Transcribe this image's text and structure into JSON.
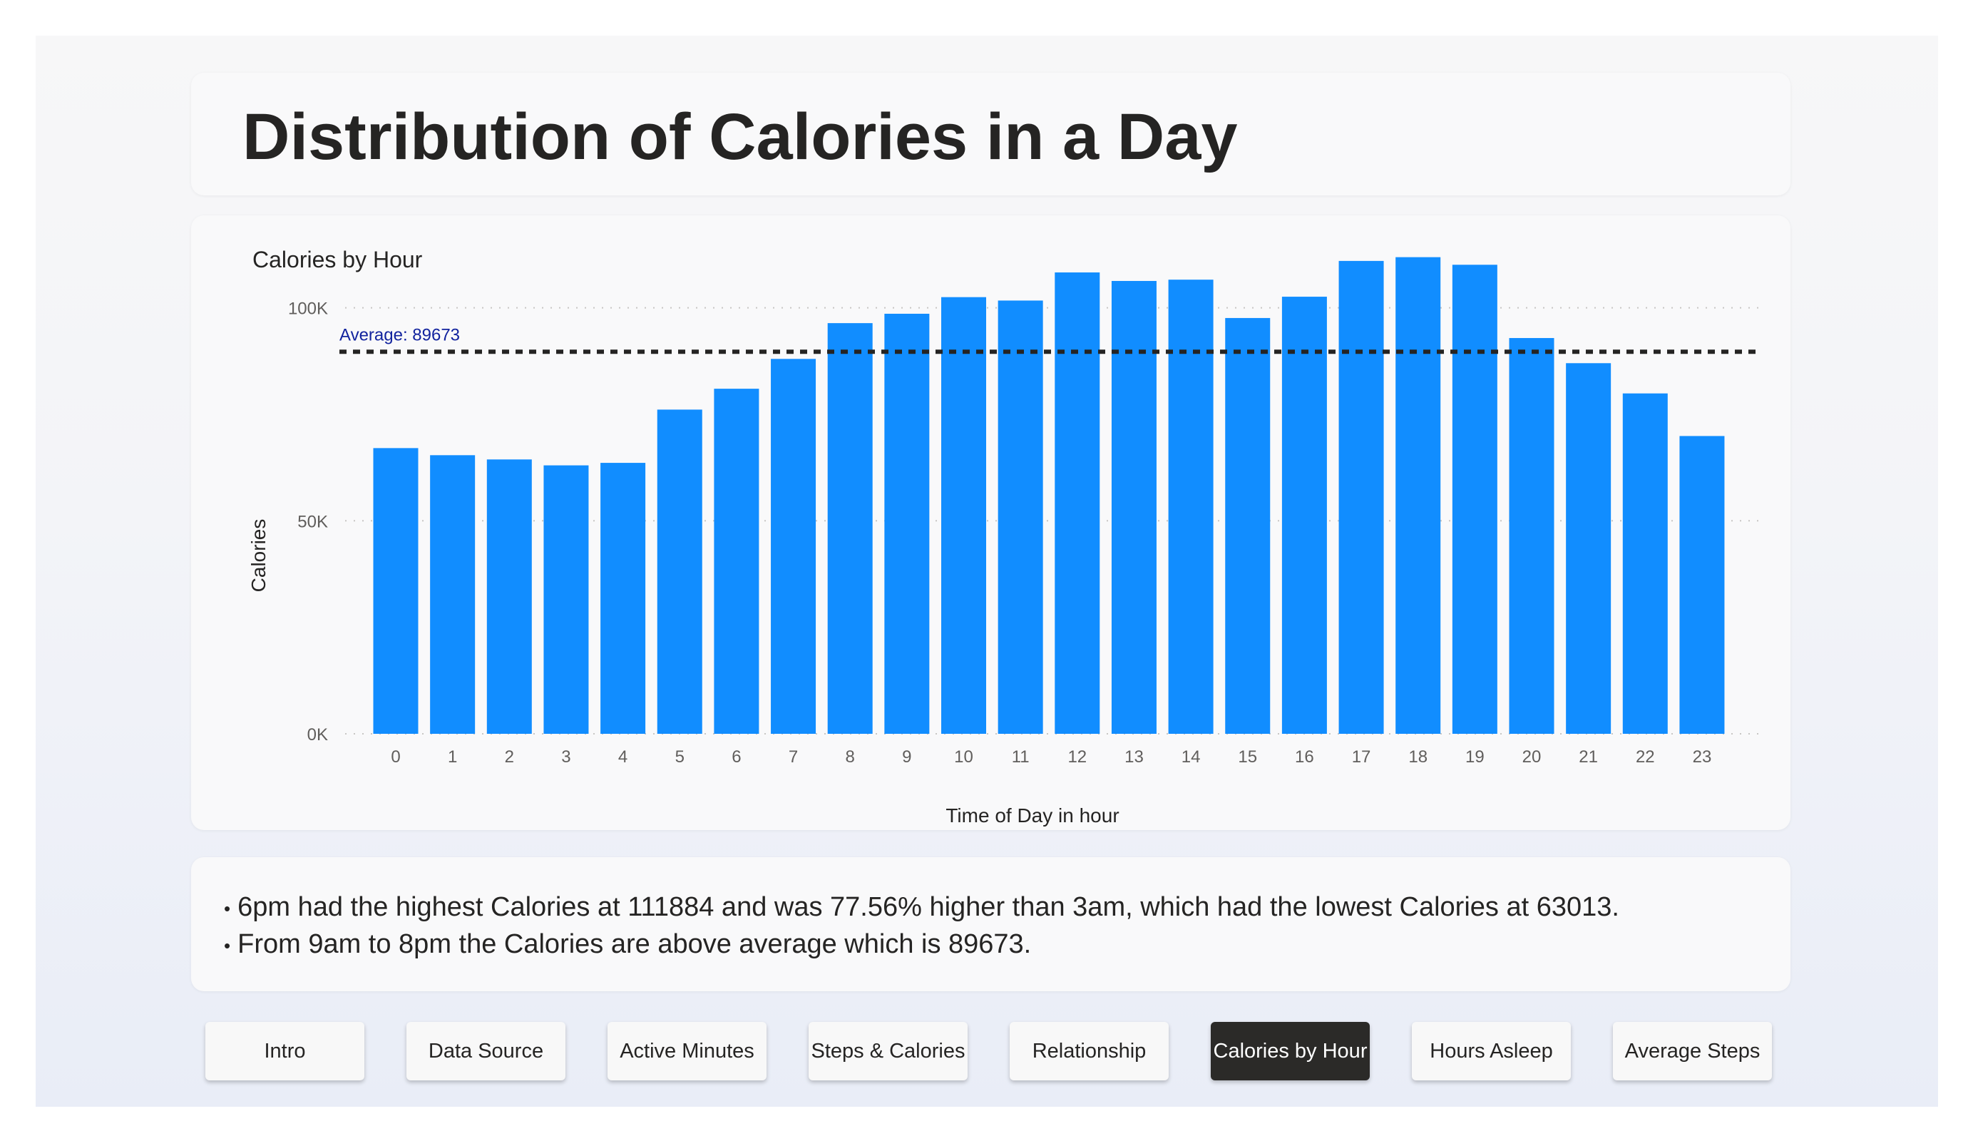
{
  "page": {
    "title": "Distribution of Calories in a Day"
  },
  "chart_data": {
    "type": "bar",
    "title": "Calories by Hour",
    "xlabel": "Time of Day in hour",
    "ylabel": "Calories",
    "categories": [
      "0",
      "1",
      "2",
      "3",
      "4",
      "5",
      "6",
      "7",
      "8",
      "9",
      "10",
      "11",
      "12",
      "13",
      "14",
      "15",
      "16",
      "17",
      "18",
      "19",
      "20",
      "21",
      "22",
      "23"
    ],
    "values": [
      67066,
      65400,
      64400,
      63013,
      63600,
      76100,
      81000,
      88000,
      96400,
      98600,
      102500,
      101700,
      108300,
      106300,
      106600,
      97600,
      102600,
      111000,
      111884,
      110100,
      92900,
      87000,
      79900,
      69900
    ],
    "ylim": [
      0,
      115000
    ],
    "yticks": [
      0,
      50000,
      100000
    ],
    "ytick_labels": [
      "0K",
      "50K",
      "100K"
    ],
    "average": 89673,
    "average_label": "Average: 89673",
    "bar_color": "#118DFF",
    "average_line_color": "#252423",
    "average_label_color": "#12239E",
    "grid": true
  },
  "insights": [
    "6pm had the highest Calories at 111884 and was 77.56% higher than 3am, which had the lowest Calories at 63013.",
    "From 9am to 8pm the Calories are above average which is 89673."
  ],
  "nav": {
    "active_index": 5,
    "buttons": [
      "Intro",
      "Data Source",
      "Active Minutes",
      "Steps & Calories",
      "Relationship",
      "Calories by Hour",
      "Hours Asleep",
      "Average Steps"
    ]
  }
}
